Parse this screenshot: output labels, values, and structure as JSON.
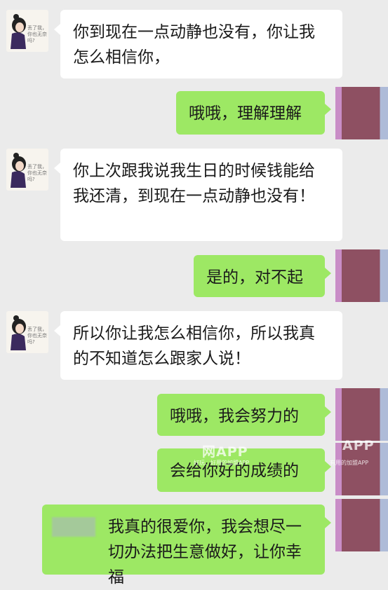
{
  "avatar_left": {
    "caption": "丢了我，你也无奈吗?"
  },
  "messages": [
    {
      "side": "left",
      "text": "你到现在一点动静也没有，你让我怎么相信你，"
    },
    {
      "side": "right",
      "text": "哦哦，理解理解"
    },
    {
      "side": "left",
      "text": "你上次跟我说我生日的时候钱能给我还清，到现在一点动静也没有！"
    },
    {
      "side": "right",
      "text": "是的，对不起"
    },
    {
      "side": "left",
      "text": "所以你让我怎么相信你，所以我真的不知道怎么跟家人说！"
    },
    {
      "side": "right",
      "text": "哦哦，我会努力的"
    },
    {
      "side": "right",
      "text": "会给你好的成绩的"
    },
    {
      "side": "right",
      "text": "我真的很爱你，我会想尽一切办法把生意做好，让你幸福"
    }
  ],
  "watermark": {
    "mark_1": "网APP",
    "mark_2": "APP",
    "sub_1": "好玩、好用的加盟APP",
    "sub_2": "有用的加盟APP"
  }
}
